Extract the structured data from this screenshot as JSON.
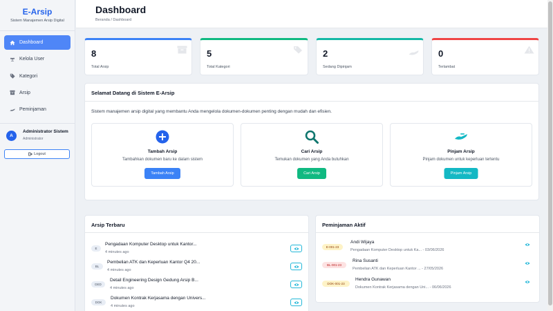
{
  "brand": {
    "title": "E-Arsip",
    "subtitle": "Sistem Manajemen Arsip Digital"
  },
  "sidebar": {
    "items": [
      {
        "label": "Dashboard",
        "icon": "home-icon"
      },
      {
        "label": "Kelola User",
        "icon": "users-icon"
      },
      {
        "label": "Kategori",
        "icon": "tag-icon"
      },
      {
        "label": "Arsip",
        "icon": "archive-icon"
      },
      {
        "label": "Peminjaman",
        "icon": "handshake-icon"
      }
    ],
    "user": {
      "initial": "A",
      "name": "Administrator Sistem",
      "role": "Administrator"
    },
    "logout_label": "Logout"
  },
  "header": {
    "title": "Dashboard",
    "breadcrumb": "Beranda / Dashboard"
  },
  "stats": [
    {
      "value": "8",
      "label": "Total Arsip",
      "color": "#3b82f6",
      "icon": "archive-icon"
    },
    {
      "value": "5",
      "label": "Total Kategori",
      "color": "#10b981",
      "icon": "tags-icon"
    },
    {
      "value": "2",
      "label": "Sedang Dipinjam",
      "color": "#14b8a6",
      "icon": "handshake-icon"
    },
    {
      "value": "0",
      "label": "Terlambat",
      "color": "#ef4444",
      "icon": "warning-icon"
    }
  ],
  "welcome": {
    "title": "Selamat Datang di Sistem E-Arsip",
    "text": "Sistem manajemen arsip digital yang membantu Anda mengelola dokumen-dokumen penting dengan mudah dan efisien.",
    "actions": [
      {
        "title": "Tambah Arsip",
        "desc": "Tambahkan dokumen baru ke dalam sistem",
        "button": "Tambah Arsip",
        "color": "#3b82f6",
        "icon": "plus-circle-icon"
      },
      {
        "title": "Cari Arsip",
        "desc": "Temukan dokumen yang Anda butuhkan",
        "button": "Cari Arsip",
        "color": "#10b981",
        "icon": "search-icon"
      },
      {
        "title": "Pinjam Arsip",
        "desc": "Pinjam dokumen untuk keperluan tertentu",
        "button": "Pinjam Arsip",
        "color": "#14b8c4",
        "icon": "handshake-icon"
      }
    ]
  },
  "recent": {
    "title": "Arsip Terbaru",
    "rows": [
      {
        "badge": "E",
        "title": "Pengadaan Komputer Desktop untuk Kantor...",
        "time": "4 minutes ago"
      },
      {
        "badge": "BL",
        "title": "Pembelian ATK dan Keperluan Kantor Q4 20...",
        "time": "4 minutes ago"
      },
      {
        "badge": "DED",
        "title": "Detail Engineering Design Gedung Arsip B...",
        "time": "4 minutes ago"
      },
      {
        "badge": "DOK",
        "title": "Dokumen Kontrak Kerjasama dengan Univers...",
        "time": "4 minutes ago"
      }
    ]
  },
  "loans": {
    "title": "Peminjaman Aktif",
    "rows": [
      {
        "badge": "E-001-23",
        "name": "Andi Wijaya",
        "detail": "Pengadaan Komputer Desktop untuk Ka... - 03/06/2026",
        "color": "amber"
      },
      {
        "badge": "BL-001-23",
        "name": "Rina Susanti",
        "detail": "Pembelian ATK dan Keperluan Kantor ... - 27/05/2026",
        "color": "red"
      },
      {
        "badge": "DOK-001-23",
        "name": "Hendra Gunawan",
        "detail": "Dokumen Kontrak Kerjasama dengan Uni... - 06/06/2026",
        "color": "amber"
      }
    ]
  }
}
